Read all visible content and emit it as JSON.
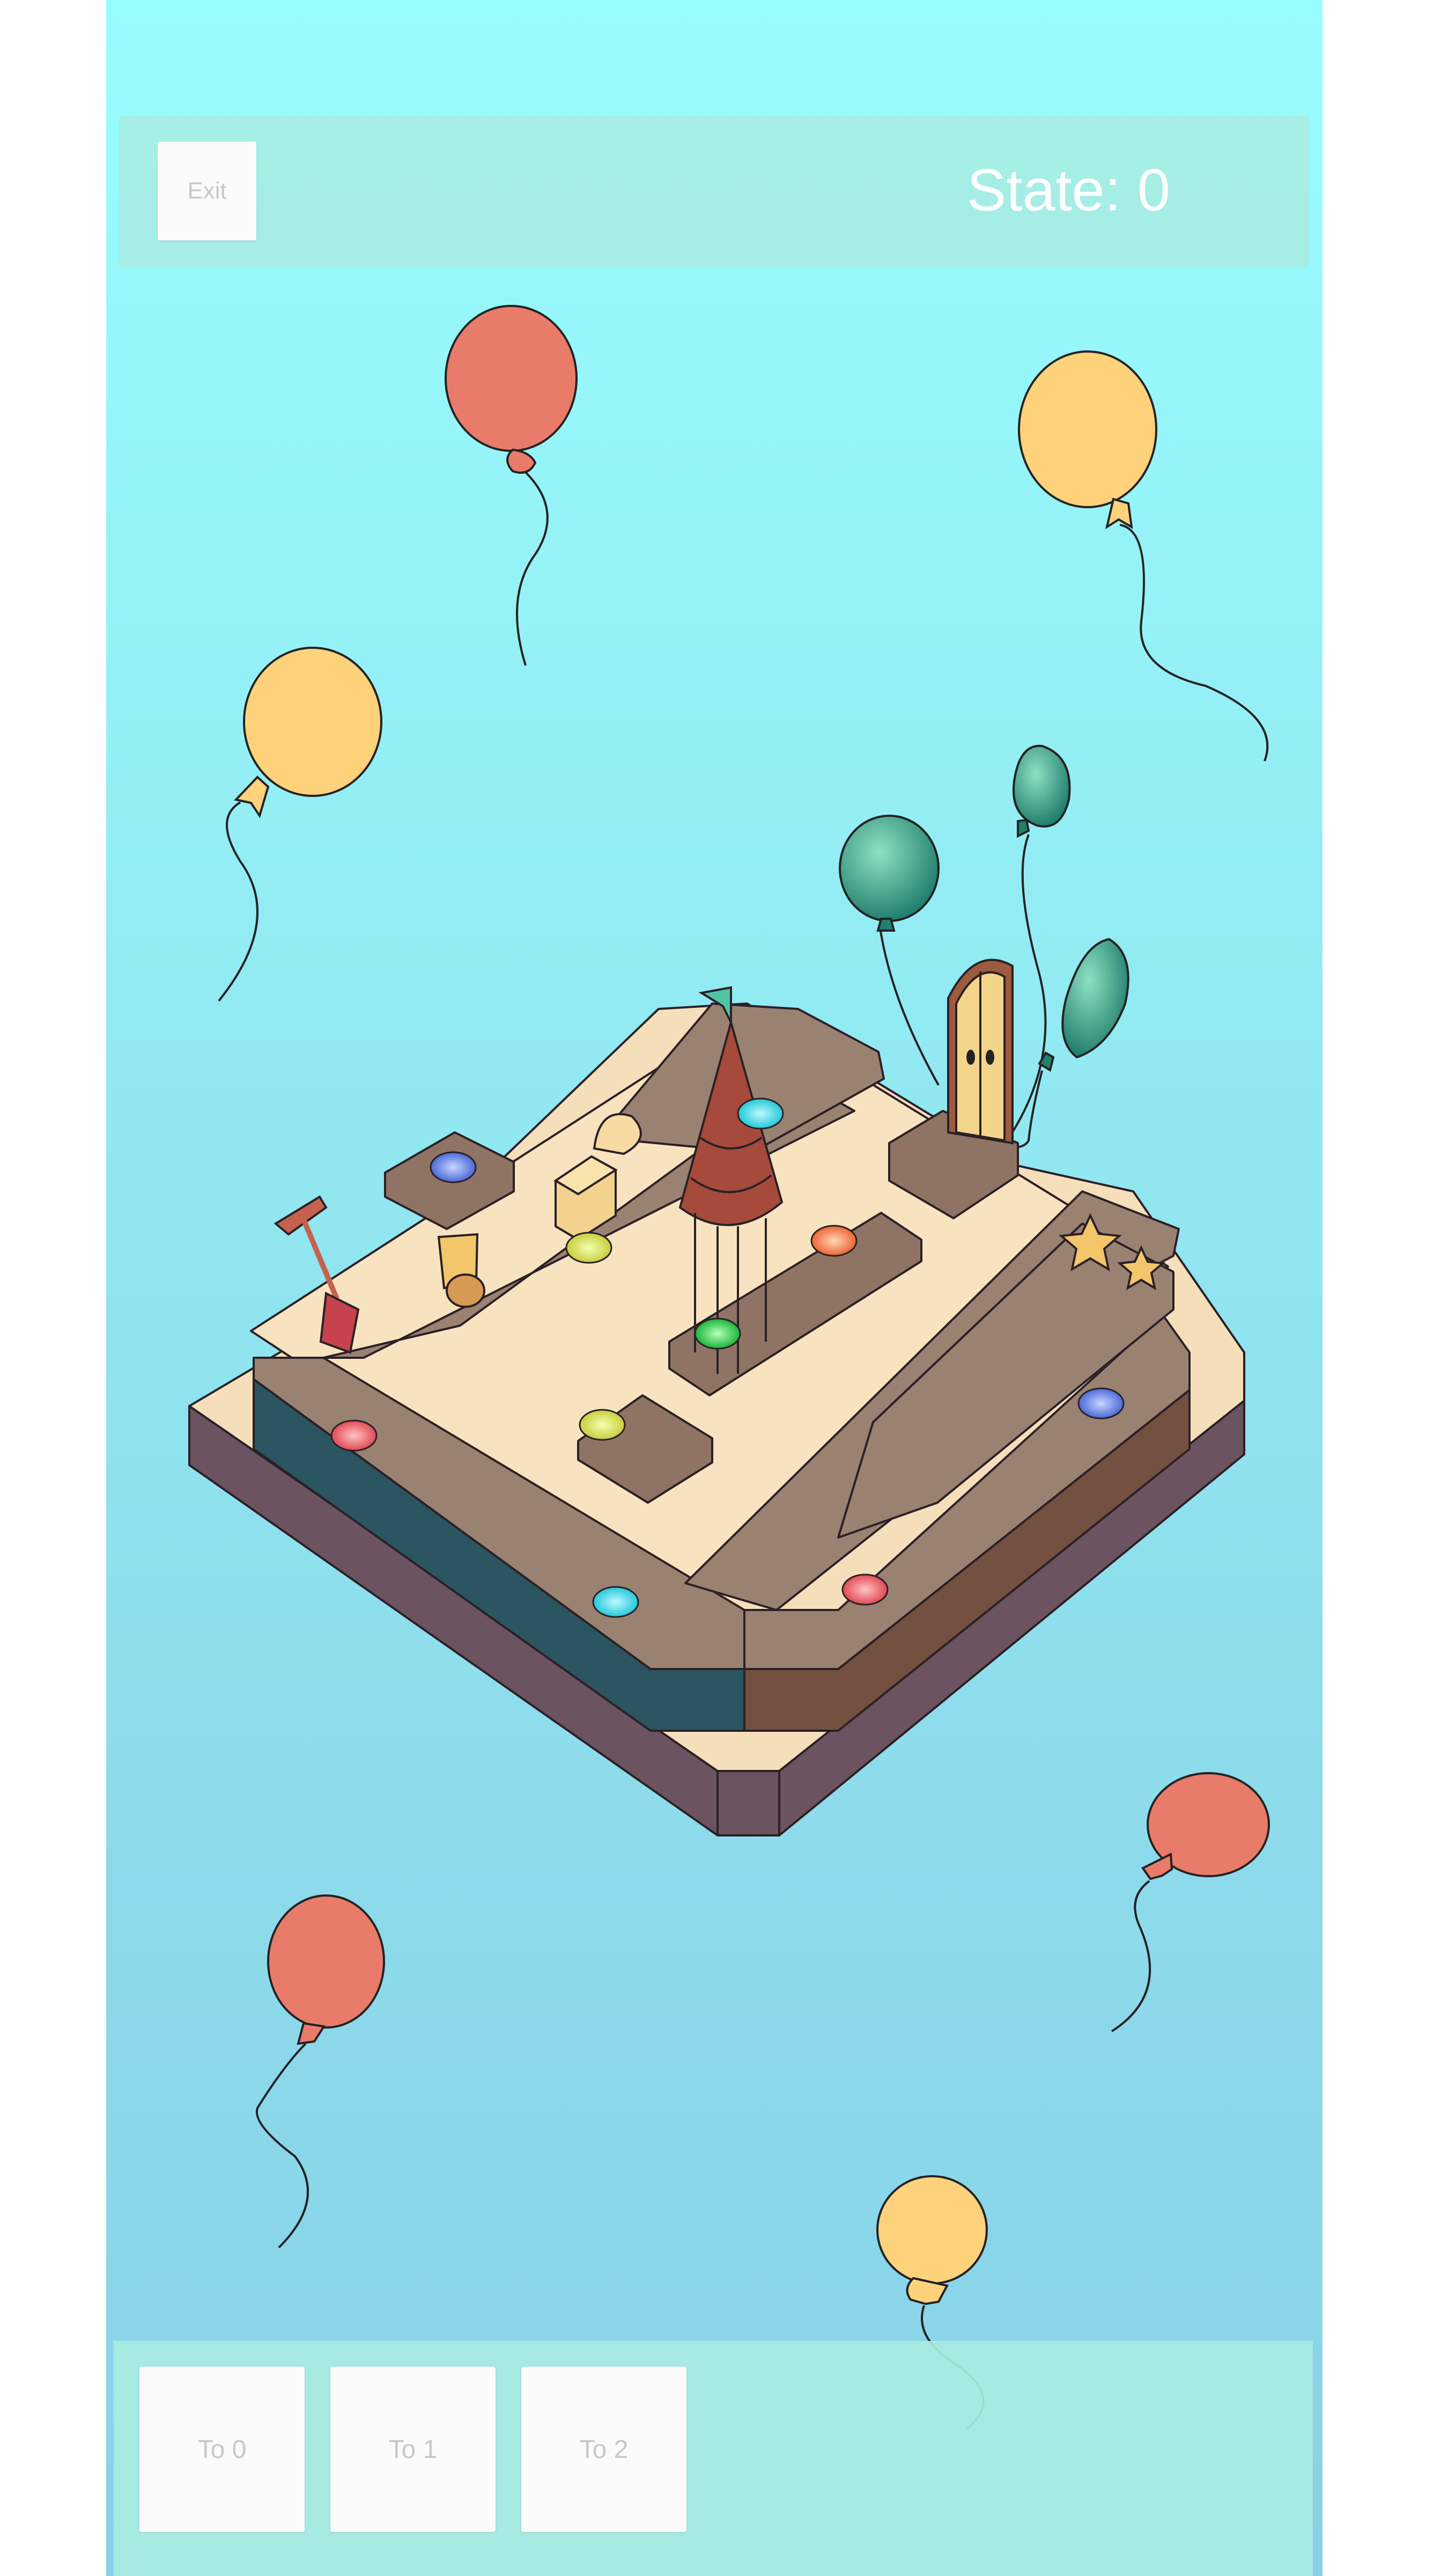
{
  "header": {
    "exit_label": "Exit",
    "state_label": "State: 0"
  },
  "footer": {
    "buttons": [
      {
        "label": "To 0"
      },
      {
        "label": "To 1"
      },
      {
        "label": "To 2"
      }
    ]
  },
  "scene": {
    "icons": [
      "red-balloon-icon",
      "yellow-balloon-icon",
      "green-balloon-icon",
      "door-icon",
      "gazebo-icon",
      "shovel-icon",
      "sand-bucket-icon",
      "shell-icon",
      "starfish-icon",
      "flag-icon",
      "glowing-button-icon"
    ]
  },
  "colors": {
    "sky_top": "#98fdfe",
    "sky_bottom": "#88d2e8",
    "balloon_red": "#e97b6a",
    "balloon_yellow": "#fed17b",
    "balloon_green": "#2d9c8a",
    "wall_brown": "#9a8272",
    "sand": "#f5dfbb",
    "panel": "#a8ece0"
  }
}
